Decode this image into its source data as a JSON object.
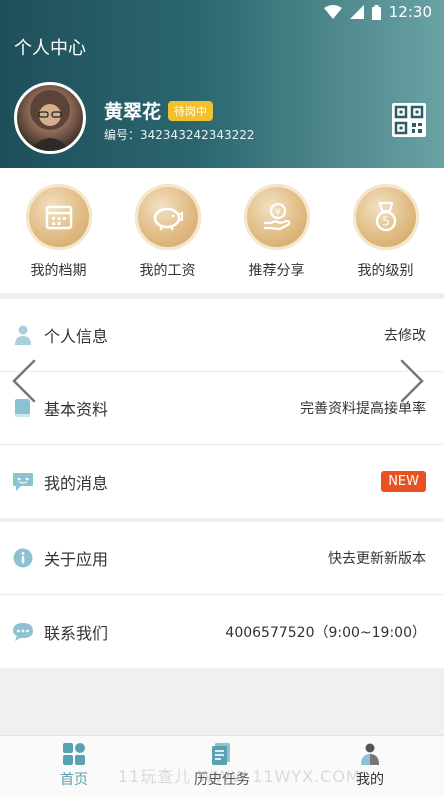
{
  "status_bar": {
    "time": "12:30"
  },
  "header": {
    "title": "个人中心"
  },
  "profile": {
    "name": "黄翠花",
    "status": "待岗中",
    "id_label": "编号：",
    "id_value": "342343242343222"
  },
  "shortcuts": [
    {
      "label": "我的档期",
      "icon": "calendar-icon"
    },
    {
      "label": "我的工资",
      "icon": "piggy-bank-icon"
    },
    {
      "label": "推荐分享",
      "icon": "hand-coin-icon"
    },
    {
      "label": "我的级别",
      "icon": "medal-icon"
    }
  ],
  "menu_group1": [
    {
      "label": "个人信息",
      "value": "去修改",
      "icon": "person-icon"
    },
    {
      "label": "基本资料",
      "value": "完善资料提高接单率",
      "icon": "book-icon"
    },
    {
      "label": "我的消息",
      "value": "NEW",
      "icon": "message-icon"
    }
  ],
  "menu_group2": [
    {
      "label": "关于应用",
      "value": "快去更新新版本",
      "icon": "info-icon"
    },
    {
      "label": "联系我们",
      "value": "4006577520（9:00~19:00）",
      "icon": "chat-icon"
    }
  ],
  "tabbar": [
    {
      "label": "首页",
      "icon": "home-grid-icon"
    },
    {
      "label": "历史任务",
      "icon": "document-icon"
    },
    {
      "label": "我的",
      "icon": "user-icon"
    }
  ],
  "watermark": "11玩查儿 WWW.11WYX.COM",
  "colors": {
    "accent": "#5aa1b3",
    "gold": "#dfb980",
    "badge_new": "#e9521f",
    "badge_status": "#f2c12e"
  }
}
